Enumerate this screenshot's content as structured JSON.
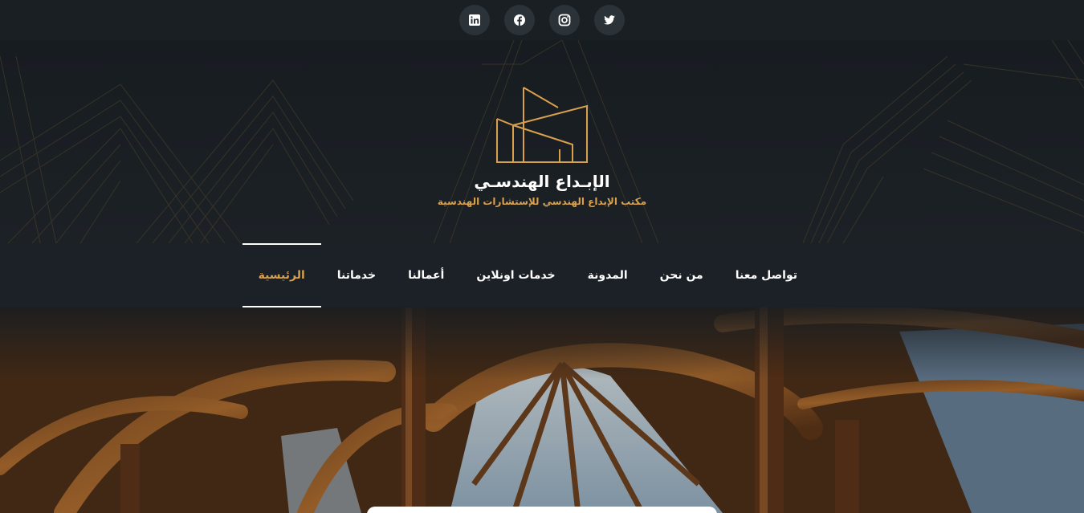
{
  "social": {
    "items": [
      {
        "name": "linkedin",
        "icon": "linkedin-icon"
      },
      {
        "name": "facebook",
        "icon": "facebook-icon"
      },
      {
        "name": "instagram",
        "icon": "instagram-icon"
      },
      {
        "name": "twitter",
        "icon": "twitter-icon"
      }
    ],
    "icon_color": "#ffffff",
    "button_bg": "#2c3338"
  },
  "header": {
    "title": "الإبـداع الهندسـي",
    "tagline": "مكتب الإبداع الهندسي للإستشارات الهندسية",
    "logo_icon": "building-outline-icon",
    "accent_color": "#d9a04d"
  },
  "nav": {
    "items": [
      {
        "label": "الرئيسية",
        "active": true
      },
      {
        "label": "خدماتنا",
        "active": false
      },
      {
        "label": "أعمالنا",
        "active": false
      },
      {
        "label": "خدمات اونلاين",
        "active": false
      },
      {
        "label": "المدونة",
        "active": false
      },
      {
        "label": "من نحن",
        "active": false
      },
      {
        "label": "تواصل معنا",
        "active": false
      }
    ]
  }
}
